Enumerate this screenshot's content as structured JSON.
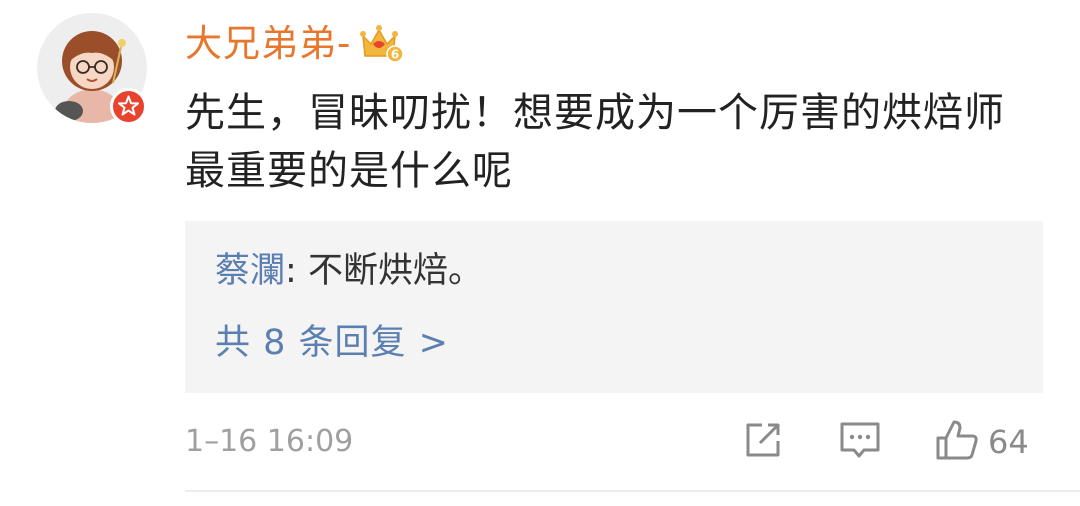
{
  "comment": {
    "username": "大兄弟弟-",
    "level_badge": "6",
    "text": "先生，冒昧叨扰！想要成为一个厉害的烘焙师最重要的是什么呢",
    "timestamp": "1–16 16:09",
    "like_count": "64"
  },
  "reply_preview": {
    "author": "蔡瀾",
    "separator": ": ",
    "text": "不断烘焙。",
    "more_label": "共 8 条回复 >"
  },
  "icons": {
    "avatar": "cartoon-girl-avatar",
    "verify": "verified-star-badge-icon",
    "level": "crown-level-icon",
    "share": "share-icon",
    "comment": "comment-icon",
    "like": "thumbs-up-icon"
  },
  "colors": {
    "username": "#e8772e",
    "link": "#5a7fb0",
    "verify_badge": "#e8432e",
    "reply_bg": "#f4f4f4",
    "meta": "#a0a0a0"
  }
}
